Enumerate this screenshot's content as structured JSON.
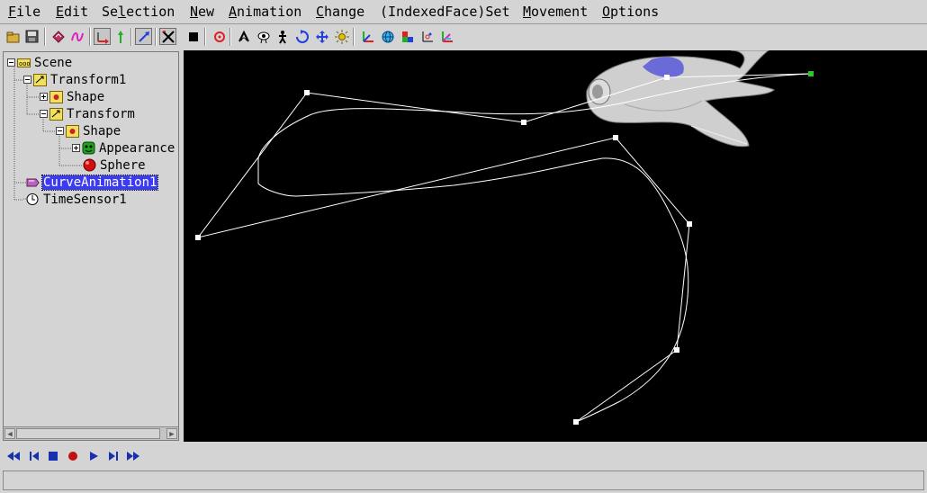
{
  "menu": [
    {
      "pre": "",
      "u": "F",
      "post": "ile"
    },
    {
      "pre": "",
      "u": "E",
      "post": "dit"
    },
    {
      "pre": "Se",
      "u": "l",
      "post": "ection"
    },
    {
      "pre": "",
      "u": "N",
      "post": "ew"
    },
    {
      "pre": "",
      "u": "A",
      "post": "nimation"
    },
    {
      "pre": "",
      "u": "C",
      "post": "hange"
    },
    {
      "pre": "(IndexedFace)Set",
      "u": "",
      "post": ""
    },
    {
      "pre": "",
      "u": "M",
      "post": "ovement"
    },
    {
      "pre": "",
      "u": "O",
      "post": "ptions"
    }
  ],
  "toolbar_icons": [
    "open-file-icon",
    "save-file-icon",
    "cut-icon",
    "curve-icon",
    "move-red-icon",
    "arrow-up-icon",
    "arrow-diag-icon",
    "x-axis-icon",
    "stop-square-icon",
    "target-icon",
    "lasso-icon",
    "eye-icon",
    "walk-icon",
    "rotate-icon",
    "move-cross-icon",
    "sun-icon",
    "axes-icon",
    "globe-icon",
    "color-axes-icon",
    "scale-axes-icon",
    "rgb-axes-icon"
  ],
  "tree": {
    "scene": "Scene",
    "transform1": "Transform1",
    "shape1": "Shape",
    "transform": "Transform",
    "shape2": "Shape",
    "appearance": "Appearance",
    "sphere": "Sphere",
    "curve_animation": "CurveAnimation1",
    "time_sensor": "TimeSensor1"
  },
  "playback": [
    "rewind-icon",
    "step-back-icon",
    "stop-icon",
    "record-icon",
    "play-icon",
    "step-forward-icon",
    "fast-forward-icon"
  ],
  "status": "",
  "colors": {
    "selection": "#3b3bf2",
    "viewport_bg": "#000000",
    "curve": "#ffffff",
    "active_point": "#22cc22"
  }
}
